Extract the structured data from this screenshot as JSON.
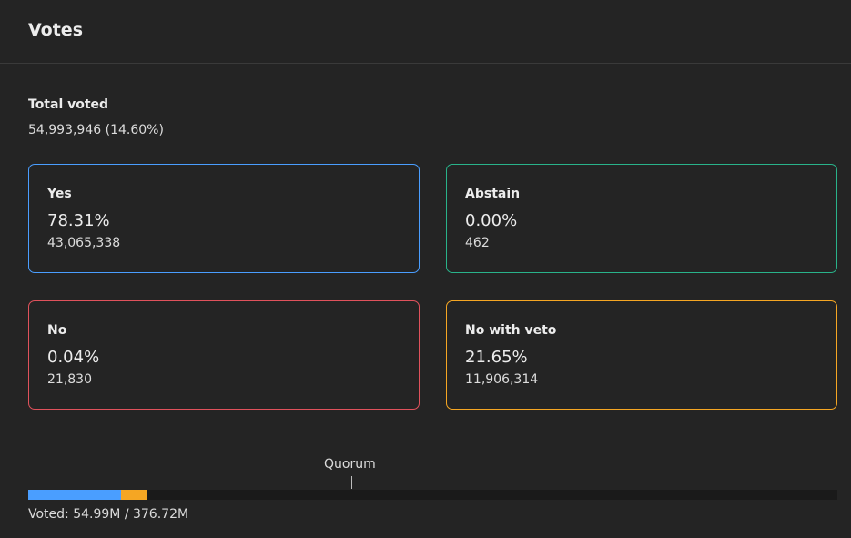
{
  "header": {
    "title": "Votes"
  },
  "total": {
    "label": "Total voted",
    "value": "54,993,946 (14.60%)"
  },
  "options": [
    {
      "key": "yes",
      "label": "Yes",
      "percent": "78.31%",
      "count": "43,065,338",
      "color": "#4a9eff"
    },
    {
      "key": "abstain",
      "label": "Abstain",
      "percent": "0.00%",
      "count": "462",
      "color": "#29b38a"
    },
    {
      "key": "no",
      "label": "No",
      "percent": "0.04%",
      "count": "21,830",
      "color": "#e0525c"
    },
    {
      "key": "veto",
      "label": "No with veto",
      "percent": "21.65%",
      "count": "11,906,314",
      "color": "#f5a623"
    }
  ],
  "quorum": {
    "label": "Quorum",
    "fraction": 0.3986
  },
  "progress": {
    "voted_fraction": 0.146,
    "segments": [
      {
        "key": "yes",
        "fraction": 0.7831,
        "color": "#4a9eff"
      },
      {
        "key": "abstain",
        "fraction": 0.0,
        "color": "#29b38a"
      },
      {
        "key": "no",
        "fraction": 0.0004,
        "color": "#e0525c"
      },
      {
        "key": "veto",
        "fraction": 0.2165,
        "color": "#f5a623"
      }
    ]
  },
  "voted_text": "Voted: 54.99M / 376.72M"
}
